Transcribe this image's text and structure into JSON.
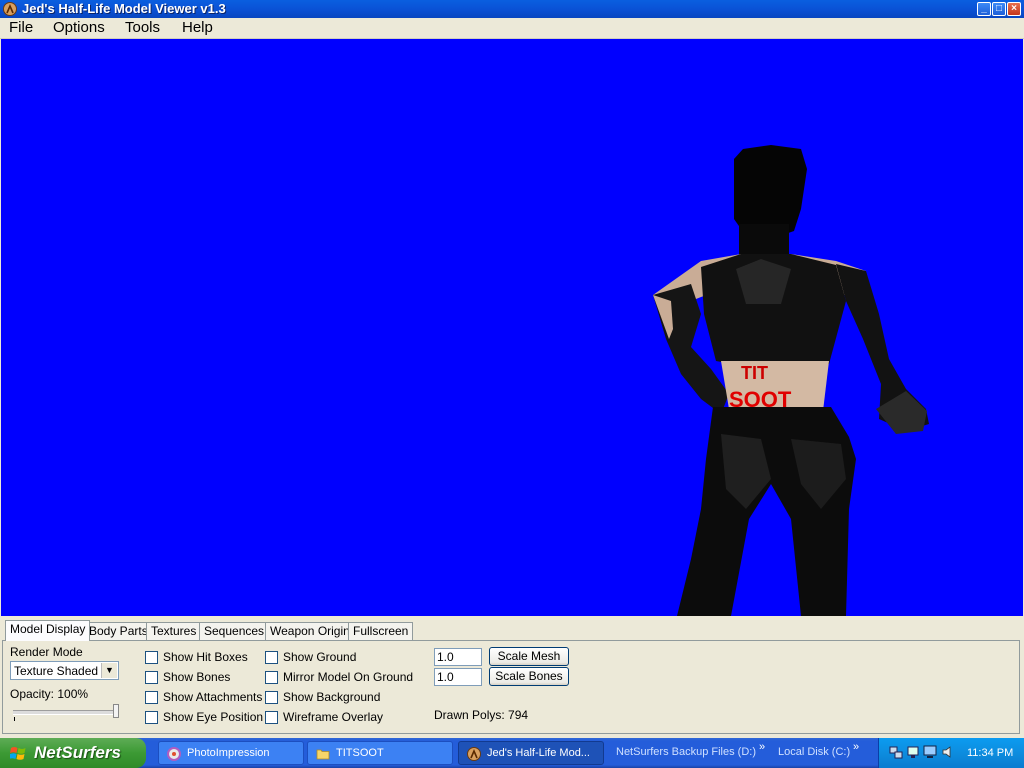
{
  "window": {
    "title": "Jed's Half-Life Model Viewer v1.3",
    "app_icon": "half-life-lambda-icon",
    "controls": {
      "minimize": "_",
      "maximize": "□",
      "close": "×"
    }
  },
  "menu": [
    "File",
    "Options",
    "Tools",
    "Help"
  ],
  "viewport": {
    "background_color": "#0000FF",
    "model_text": "TIT SOOT"
  },
  "tabs": [
    "Model Display",
    "Body Parts",
    "Textures",
    "Sequences",
    "Weapon Origin",
    "Fullscreen"
  ],
  "active_tab": "Model Display",
  "model_display": {
    "render_mode_label": "Render Mode",
    "render_mode_value": "Texture Shaded",
    "opacity_label": "Opacity: 100%",
    "opacity_fraction": 1.0,
    "checkboxes_col1": [
      {
        "label": "Show Hit Boxes",
        "checked": false
      },
      {
        "label": "Show Bones",
        "checked": false
      },
      {
        "label": "Show Attachments",
        "checked": false
      },
      {
        "label": "Show Eye Position",
        "checked": false
      }
    ],
    "checkboxes_col2": [
      {
        "label": "Show Ground",
        "checked": false
      },
      {
        "label": "Mirror Model On Ground",
        "checked": false
      },
      {
        "label": "Show Background",
        "checked": false
      },
      {
        "label": "Wireframe Overlay",
        "checked": false
      }
    ],
    "scale_mesh_value": "1.0",
    "scale_mesh_button": "Scale Mesh",
    "scale_bones_value": "1.0",
    "scale_bones_button": "Scale Bones",
    "drawn_polys": "Drawn Polys: 794"
  },
  "taskbar": {
    "start_label": "NetSurfers",
    "tasks": [
      {
        "label": "PhotoImpression",
        "icon": "photoimpression-icon",
        "active": false
      },
      {
        "label": "TITSOOT",
        "icon": "folder-icon",
        "active": false
      },
      {
        "label": "Jed's Half-Life Mod...",
        "icon": "half-life-lambda-icon",
        "active": true
      }
    ],
    "toolbars": [
      "NetSurfers Backup Files (D:)",
      "Local Disk (C:)"
    ],
    "chevron": "»",
    "clock": "11:34 PM"
  }
}
